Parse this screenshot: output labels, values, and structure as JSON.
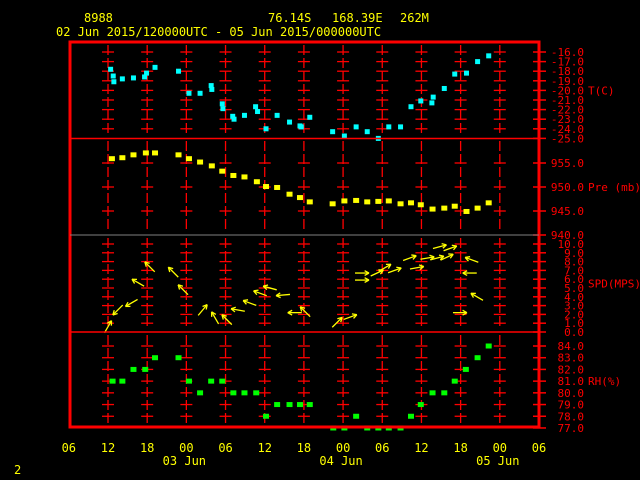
{
  "header": {
    "station_id": "8988",
    "latitude": "76.14S",
    "longitude": "168.39E",
    "elevation": "262M",
    "time_range": "02 Jun 2015/120000UTC - 05 Jun 2015/000000UTC"
  },
  "page_number": "2",
  "colors": {
    "frame": "#ff0000",
    "temperature": "#00ffff",
    "pressure": "#ffff00",
    "wind": "#ffff00",
    "rh": "#00ff00",
    "text": "#ffff00"
  },
  "chart_data": {
    "type": "scatter",
    "title": "Station 8988 time series",
    "time_units": "hours since 02 Jun 2015 12:00 UTC",
    "x_ticks": [
      {
        "t": -6,
        "label": "06"
      },
      {
        "t": 0,
        "label": "12"
      },
      {
        "t": 6,
        "label": "18"
      },
      {
        "t": 12,
        "label": "00"
      },
      {
        "t": 18,
        "label": "06"
      },
      {
        "t": 24,
        "label": "12"
      },
      {
        "t": 30,
        "label": "18"
      },
      {
        "t": 36,
        "label": "00"
      },
      {
        "t": 42,
        "label": "06"
      },
      {
        "t": 48,
        "label": "12"
      },
      {
        "t": 54,
        "label": "18"
      },
      {
        "t": 60,
        "label": "00"
      },
      {
        "t": 66,
        "label": "06"
      }
    ],
    "date_labels": [
      {
        "t": 12,
        "label": "03 Jun"
      },
      {
        "t": 36,
        "label": "04 Jun"
      },
      {
        "t": 60,
        "label": "05 Jun"
      }
    ],
    "panels": {
      "temperature": {
        "label": "T(C)",
        "ylim": [
          -25,
          -16
        ],
        "ticks": [
          "-16.0",
          "-17.0",
          "-18.0",
          "-19.0",
          "-20.0",
          "-21.0",
          "-22.0",
          "-23.0",
          "-24.0",
          "-25.0"
        ],
        "points": [
          [
            0.4,
            -17.8
          ],
          [
            0.8,
            -18.5
          ],
          [
            0.9,
            -19.1
          ],
          [
            2.2,
            -18.8
          ],
          [
            3.9,
            -18.7
          ],
          [
            5.6,
            -18.6
          ],
          [
            5.9,
            -18.2
          ],
          [
            7.2,
            -17.6
          ],
          [
            10.8,
            -18.0
          ],
          [
            12.4,
            -20.3
          ],
          [
            14.1,
            -20.3
          ],
          [
            15.8,
            -19.5
          ],
          [
            15.9,
            -19.9
          ],
          [
            17.5,
            -21.4
          ],
          [
            17.6,
            -21.9
          ],
          [
            19.1,
            -22.7
          ],
          [
            19.3,
            -23.0
          ],
          [
            20.9,
            -22.6
          ],
          [
            22.6,
            -21.7
          ],
          [
            22.9,
            -22.2
          ],
          [
            24.2,
            -24.0
          ],
          [
            25.9,
            -22.6
          ],
          [
            27.8,
            -23.3
          ],
          [
            29.4,
            -23.7
          ],
          [
            29.6,
            -23.8
          ],
          [
            30.9,
            -22.8
          ],
          [
            34.4,
            -24.3
          ],
          [
            36.2,
            -24.75
          ],
          [
            38,
            -23.8
          ],
          [
            39.7,
            -24.3
          ],
          [
            41.4,
            -25.0
          ],
          [
            43,
            -23.8
          ],
          [
            44.8,
            -23.8
          ],
          [
            46.4,
            -21.7
          ],
          [
            47.9,
            -21.1
          ],
          [
            49.6,
            -21.3
          ],
          [
            49.8,
            -20.7
          ],
          [
            51.5,
            -19.8
          ],
          [
            53.1,
            -18.3
          ],
          [
            54.9,
            -18.2
          ],
          [
            56.6,
            -17.0
          ],
          [
            58.3,
            -16.4
          ]
        ]
      },
      "pressure": {
        "label": "Pre (mb)",
        "ticks": [
          "955.0",
          "950.0",
          "945.0",
          "940.0"
        ],
        "points": [
          [
            0.6,
            955.9
          ],
          [
            2.2,
            956.1
          ],
          [
            3.9,
            956.7
          ],
          [
            5.8,
            957.1
          ],
          [
            7.2,
            957.1
          ],
          [
            10.8,
            956.7
          ],
          [
            12.4,
            955.9
          ],
          [
            14.1,
            955.2
          ],
          [
            15.9,
            954.4
          ],
          [
            17.5,
            953.3
          ],
          [
            19.2,
            952.4
          ],
          [
            20.9,
            952.1
          ],
          [
            22.8,
            951.1
          ],
          [
            24.2,
            950.1
          ],
          [
            25.9,
            949.9
          ],
          [
            27.8,
            948.5
          ],
          [
            29.4,
            947.8
          ],
          [
            30.9,
            946.9
          ],
          [
            34.4,
            946.5
          ],
          [
            36.2,
            947.1
          ],
          [
            38,
            947.2
          ],
          [
            39.7,
            946.9
          ],
          [
            41.4,
            947.0
          ],
          [
            43,
            947.1
          ],
          [
            44.8,
            946.5
          ],
          [
            46.4,
            946.7
          ],
          [
            47.9,
            946.3
          ],
          [
            49.7,
            945.4
          ],
          [
            51.5,
            945.6
          ],
          [
            53.1,
            946.0
          ],
          [
            54.9,
            944.9
          ],
          [
            56.6,
            945.6
          ],
          [
            58.3,
            946.7
          ]
        ]
      },
      "wind_speed": {
        "label": "SPD(MPS)",
        "ylim": [
          0,
          10
        ],
        "ticks": [
          "10.0",
          "9.0",
          "8.0",
          "7.0",
          "6.0",
          "5.0",
          "4.0",
          "3.0",
          "2.0",
          "1.0",
          "0.0"
        ],
        "arrows_t_speed_pointing_deg": [
          [
            0,
            0.6,
            60
          ],
          [
            1.5,
            2.5,
            225
          ],
          [
            3.6,
            3.3,
            210
          ],
          [
            4.6,
            5.6,
            150
          ],
          [
            6.4,
            7.4,
            135
          ],
          [
            10,
            6.8,
            135
          ],
          [
            11.5,
            4.8,
            135
          ],
          [
            14.5,
            2.5,
            50
          ],
          [
            16.4,
            1.6,
            120
          ],
          [
            18.2,
            1.4,
            135
          ],
          [
            19.9,
            2.5,
            170
          ],
          [
            21.7,
            3.3,
            160
          ],
          [
            23.3,
            4.4,
            160
          ],
          [
            24.8,
            5,
            165
          ],
          [
            26.8,
            4.2,
            185
          ],
          [
            28.6,
            2.2,
            180
          ],
          [
            30.2,
            2.3,
            135
          ],
          [
            35.1,
            1.1,
            45
          ],
          [
            37.1,
            1.7,
            20
          ],
          [
            38.9,
            6.7,
            0
          ],
          [
            38.9,
            5.9,
            0
          ],
          [
            41.2,
            6.7,
            25
          ],
          [
            42.4,
            7.3,
            30
          ],
          [
            43.9,
            7.0,
            20
          ],
          [
            46.2,
            8.4,
            20
          ],
          [
            47.3,
            7.3,
            10
          ],
          [
            48.9,
            8.4,
            10
          ],
          [
            50.4,
            8.4,
            15
          ],
          [
            51.9,
            8.5,
            25
          ],
          [
            50.8,
            9.7,
            15
          ],
          [
            52.4,
            9.5,
            20
          ],
          [
            55.7,
            8.2,
            160
          ],
          [
            55.4,
            6.7,
            180
          ],
          [
            56.5,
            4.0,
            150
          ],
          [
            53.9,
            2.2,
            0
          ]
        ]
      },
      "rh": {
        "label": "RH(%)",
        "ylim": [
          77,
          84
        ],
        "ticks": [
          "84.0",
          "83.0",
          "82.0",
          "81.0",
          "80.0",
          "79.0",
          "78.0",
          "77.0"
        ],
        "points": [
          [
            0.7,
            81
          ],
          [
            2.2,
            81
          ],
          [
            3.9,
            82
          ],
          [
            5.7,
            82
          ],
          [
            7.2,
            83
          ],
          [
            10.8,
            83
          ],
          [
            12.4,
            81
          ],
          [
            14.1,
            80
          ],
          [
            15.8,
            81
          ],
          [
            17.5,
            81
          ],
          [
            19.2,
            80
          ],
          [
            20.9,
            80
          ],
          [
            22.7,
            80
          ],
          [
            24.2,
            78
          ],
          [
            25.9,
            79
          ],
          [
            27.8,
            79
          ],
          [
            29.4,
            79
          ],
          [
            30.9,
            79
          ],
          [
            34.5,
            77
          ],
          [
            36.2,
            77
          ],
          [
            38,
            78
          ],
          [
            39.7,
            77
          ],
          [
            41.4,
            77
          ],
          [
            43,
            77
          ],
          [
            44.8,
            77
          ],
          [
            46.4,
            78
          ],
          [
            47.9,
            79
          ],
          [
            49.7,
            80
          ],
          [
            51.5,
            80
          ],
          [
            53.1,
            81
          ],
          [
            54.8,
            82
          ],
          [
            56.6,
            83
          ],
          [
            58.3,
            84
          ]
        ]
      }
    }
  }
}
